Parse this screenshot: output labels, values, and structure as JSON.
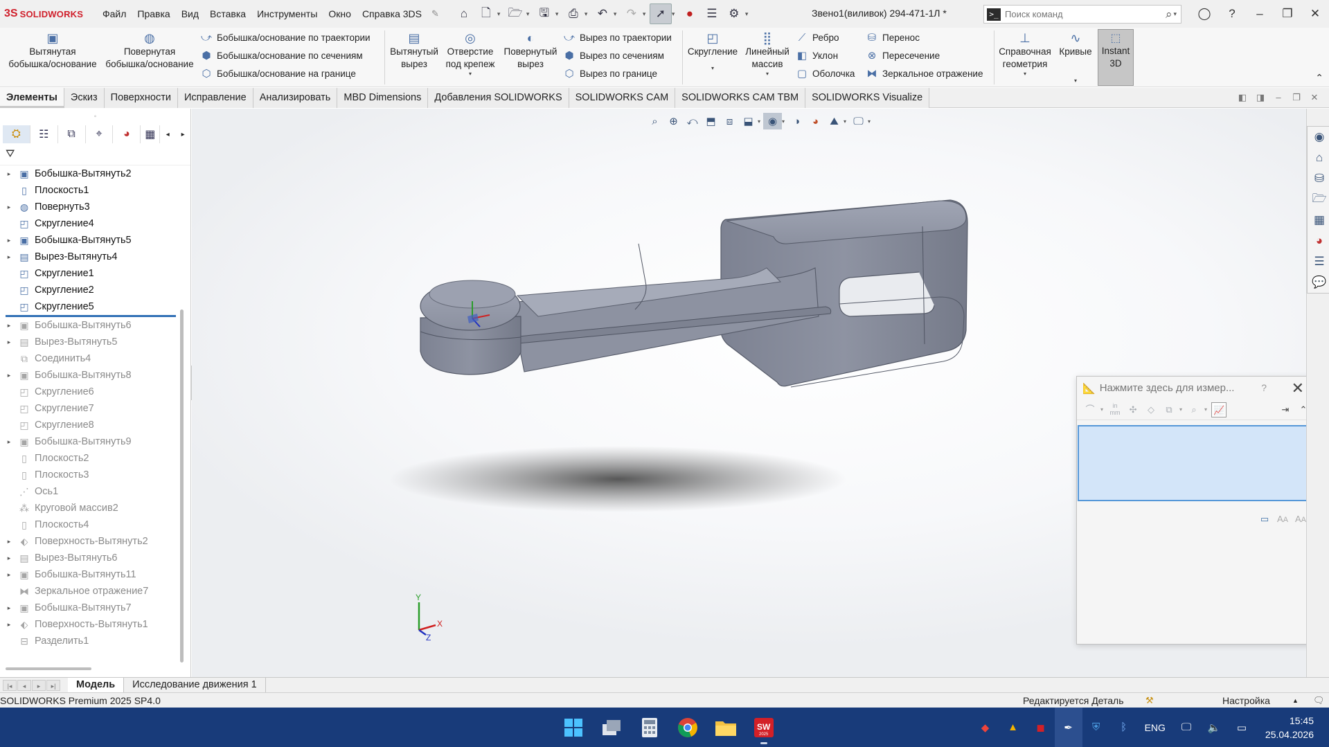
{
  "app": {
    "logo_ds": "3S",
    "logo_text": "SOLIDWORKS",
    "document_title": "Звено1(виливок) 294-471-1Л *",
    "menu": [
      "Файл",
      "Правка",
      "Вид",
      "Вставка",
      "Инструменты",
      "Окно",
      "Справка 3DS"
    ],
    "search_placeholder": "Поиск команд"
  },
  "ribbon": {
    "extruded_boss": [
      "Вытянутая",
      "бобышка/основание"
    ],
    "revolved_boss": [
      "Повернутая",
      "бобышка/основание"
    ],
    "boss_group": [
      "Бобышка/основание по траектории",
      "Бобышка/основание по сечениям",
      "Бобышка/основание на границе"
    ],
    "extruded_cut": [
      "Вытянутый",
      "вырез"
    ],
    "hole_wizard": [
      "Отверстие",
      "под крепеж"
    ],
    "revolved_cut": [
      "Повернутый",
      "вырез"
    ],
    "cut_group": [
      "Вырез по траектории",
      "Вырез по сечениям",
      "Вырез по границе"
    ],
    "fillet": "Скругление",
    "linear_pattern": [
      "Линейный",
      "массив"
    ],
    "feature_group": [
      "Ребро",
      "Уклон",
      "Оболочка"
    ],
    "move_group": [
      "Перенос",
      "Пересечение",
      "Зеркальное отражение"
    ],
    "ref_geometry": [
      "Справочная",
      "геометрия"
    ],
    "curves": "Кривые",
    "instant3d": [
      "Instant",
      "3D"
    ]
  },
  "tabs": [
    "Элементы",
    "Эскиз",
    "Поверхности",
    "Исправление",
    "Анализировать",
    "MBD Dimensions",
    "Добавления SOLIDWORKS",
    "SOLIDWORKS CAM",
    "SOLIDWORKS CAM TBM",
    "SOLIDWORKS Visualize"
  ],
  "tree": [
    {
      "label": "Бобышка-Вытянуть2",
      "expand": true,
      "suppressed": false,
      "icon": "extrude-icon"
    },
    {
      "label": "Плоскость1",
      "expand": false,
      "suppressed": false,
      "icon": "plane-icon"
    },
    {
      "label": "Повернуть3",
      "expand": true,
      "suppressed": false,
      "icon": "revolve-icon"
    },
    {
      "label": "Скругление4",
      "expand": false,
      "suppressed": false,
      "icon": "fillet-icon"
    },
    {
      "label": "Бобышка-Вытянуть5",
      "expand": true,
      "suppressed": false,
      "icon": "extrude-icon"
    },
    {
      "label": "Вырез-Вытянуть4",
      "expand": true,
      "suppressed": false,
      "icon": "cut-icon"
    },
    {
      "label": "Скругление1",
      "expand": false,
      "suppressed": false,
      "icon": "fillet-icon"
    },
    {
      "label": "Скругление2",
      "expand": false,
      "suppressed": false,
      "icon": "fillet-icon"
    },
    {
      "label": "Скругление5",
      "expand": false,
      "suppressed": false,
      "icon": "fillet-icon"
    },
    {
      "label": "Бобышка-Вытянуть6",
      "expand": true,
      "suppressed": true,
      "icon": "extrude-icon"
    },
    {
      "label": "Вырез-Вытянуть5",
      "expand": true,
      "suppressed": true,
      "icon": "cut-icon"
    },
    {
      "label": "Соединить4",
      "expand": false,
      "suppressed": true,
      "icon": "combine-icon"
    },
    {
      "label": "Бобышка-Вытянуть8",
      "expand": true,
      "suppressed": true,
      "icon": "extrude-icon"
    },
    {
      "label": "Скругление6",
      "expand": false,
      "suppressed": true,
      "icon": "fillet-icon"
    },
    {
      "label": "Скругление7",
      "expand": false,
      "suppressed": true,
      "icon": "fillet-icon"
    },
    {
      "label": "Скругление8",
      "expand": false,
      "suppressed": true,
      "icon": "fillet-icon"
    },
    {
      "label": "Бобышка-Вытянуть9",
      "expand": true,
      "suppressed": true,
      "icon": "extrude-icon"
    },
    {
      "label": "Плоскость2",
      "expand": false,
      "suppressed": true,
      "icon": "plane-icon"
    },
    {
      "label": "Плоскость3",
      "expand": false,
      "suppressed": true,
      "icon": "plane-icon"
    },
    {
      "label": "Ось1",
      "expand": false,
      "suppressed": true,
      "icon": "axis-icon"
    },
    {
      "label": "Круговой массив2",
      "expand": false,
      "suppressed": true,
      "icon": "pattern-icon"
    },
    {
      "label": "Плоскость4",
      "expand": false,
      "suppressed": true,
      "icon": "plane-icon"
    },
    {
      "label": "Поверхность-Вытянуть2",
      "expand": true,
      "suppressed": true,
      "icon": "surface-icon"
    },
    {
      "label": "Вырез-Вытянуть6",
      "expand": true,
      "suppressed": true,
      "icon": "cut-icon"
    },
    {
      "label": "Бобышка-Вытянуть11",
      "expand": true,
      "suppressed": true,
      "icon": "extrude-icon"
    },
    {
      "label": "Зеркальное отражение7",
      "expand": false,
      "suppressed": true,
      "icon": "mirror-icon"
    },
    {
      "label": "Бобышка-Вытянуть7",
      "expand": true,
      "suppressed": true,
      "icon": "extrude-icon"
    },
    {
      "label": "Поверхность-Вытянуть1",
      "expand": true,
      "suppressed": true,
      "icon": "surface-icon"
    },
    {
      "label": "Разделить1",
      "expand": false,
      "suppressed": true,
      "icon": "split-icon"
    }
  ],
  "measure": {
    "title": "Нажмите здесь для измер...",
    "help": "?",
    "close": "✕",
    "unit_icon": "in mm"
  },
  "triad": {
    "x": "X",
    "y": "Y",
    "z": "Z"
  },
  "bottom_tabs": [
    "Модель",
    "Исследование движения 1"
  ],
  "status": {
    "left": "SOLIDWORKS Premium 2025 SP4.0",
    "mode": "Редактируется Деталь",
    "custom": "Настройка"
  },
  "taskbar": {
    "lang": "ENG",
    "time": "15:45",
    "date": "25.04.2026",
    "sw_label": "SW",
    "sw_year": "2025"
  },
  "colors": {
    "model": "#8a8f9e",
    "taskbar": "#183b7a",
    "accent": "#d01f2b",
    "selection": "#d3e5f9"
  }
}
